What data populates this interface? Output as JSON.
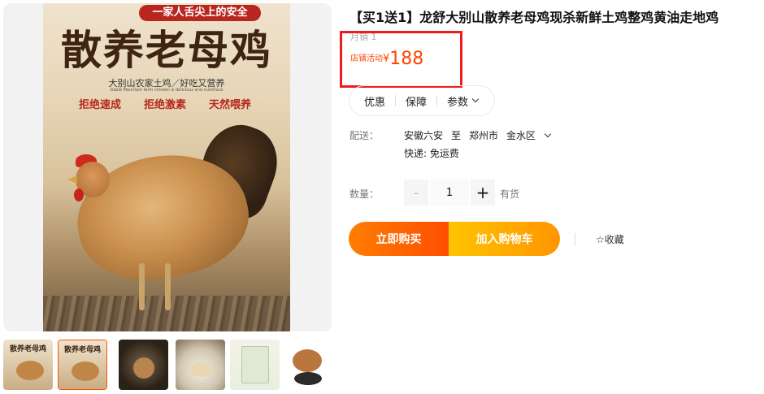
{
  "product": {
    "title": "【买1送1】龙舒大别山散养老母鸡现杀新鲜土鸡整鸡黄油走地鸡",
    "sales": "月销 1",
    "price_label": "店铺活动",
    "currency": "¥",
    "price": "188"
  },
  "poster": {
    "banner": "一家人舌尖上的安全",
    "headline": "散养老母鸡",
    "subtitle": "大别山农家土鸡／好吃又营养",
    "tiny": "Dabie Mountain farm chicken is delicious and nutritious",
    "tags": [
      "拒绝速成",
      "拒绝激素",
      "天然喂养"
    ]
  },
  "tabs": {
    "discount": "优惠",
    "guarantee": "保障",
    "params": "参数"
  },
  "shipping": {
    "label": "配送：",
    "origin": "安徽六安",
    "to": "至",
    "city": "郑州市",
    "district": "金水区",
    "express": "快递: 免运费"
  },
  "quantity": {
    "label": "数量：",
    "minus": "-",
    "value": "1",
    "plus": "+",
    "stock": "有货"
  },
  "actions": {
    "buy_now": "立即购买",
    "add_to_cart": "加入购物车",
    "favorite": "☆收藏"
  },
  "thumbnails": {
    "t1_title": "散养老母鸡",
    "t2_title": "散养老母鸡"
  },
  "colors": {
    "accent": "#ff4400",
    "highlight_box": "#ee1c1c",
    "buy_gradient": [
      "#ff7d00",
      "#ff4e00"
    ],
    "cart_gradient": [
      "#ffc400",
      "#ff9500"
    ]
  }
}
